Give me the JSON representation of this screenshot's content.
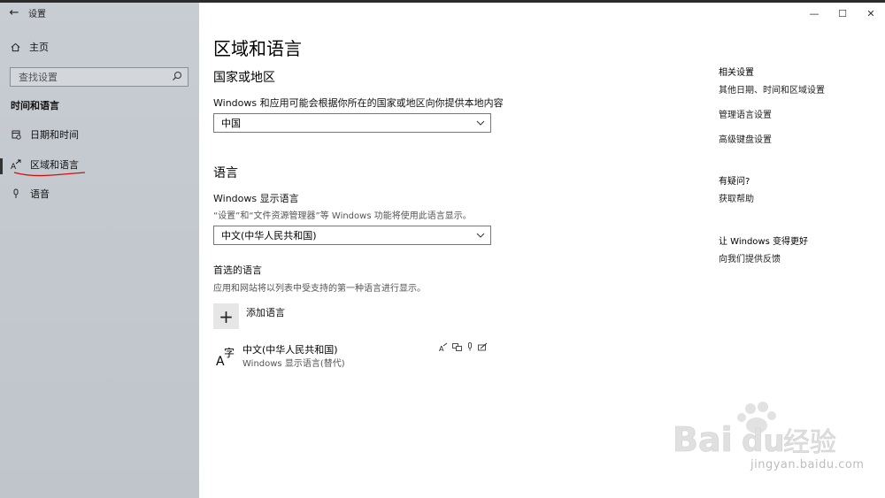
{
  "window": {
    "title": "设置"
  },
  "sidebar": {
    "home_label": "主页",
    "search_placeholder": "查找设置",
    "section_title": "时间和语言",
    "items": [
      {
        "label": "日期和时间",
        "icon": "calendar-clock-icon"
      },
      {
        "label": "区域和语言",
        "icon": "region-language-icon",
        "active": true
      },
      {
        "label": "语音",
        "icon": "microphone-icon"
      }
    ]
  },
  "main": {
    "title": "区域和语言",
    "country": {
      "heading": "国家或地区",
      "description": "Windows 和应用可能会根据你所在的国家或地区向你提供本地内容",
      "selected": "中国"
    },
    "language": {
      "heading": "语言",
      "display_label": "Windows 显示语言",
      "display_desc": "“设置”和“文件资源管理器”等 Windows 功能将使用此语言显示。",
      "display_selected": "中文(中华人民共和国)",
      "preferred_label": "首选的语言",
      "preferred_desc": "应用和网站将以列表中受支持的第一种语言进行显示。",
      "add_label": "添加语言",
      "entries": [
        {
          "name": "中文(中华人民共和国)",
          "desc": "Windows 显示语言(替代)"
        }
      ]
    }
  },
  "related": {
    "heading": "相关设置",
    "links": [
      "其他日期、时间和区域设置",
      "管理语言设置",
      "高级键盘设置"
    ]
  },
  "help": {
    "heading": "有疑问?",
    "link": "获取帮助"
  },
  "feedback": {
    "heading": "让 Windows 变得更好",
    "link": "向我们提供反馈"
  },
  "watermark": {
    "brand": "Baidu经验",
    "url": "jingyan.baidu.com"
  },
  "colors": {
    "sidebar_bg": "#c4c9cf",
    "accent_underline": "#d01010"
  }
}
